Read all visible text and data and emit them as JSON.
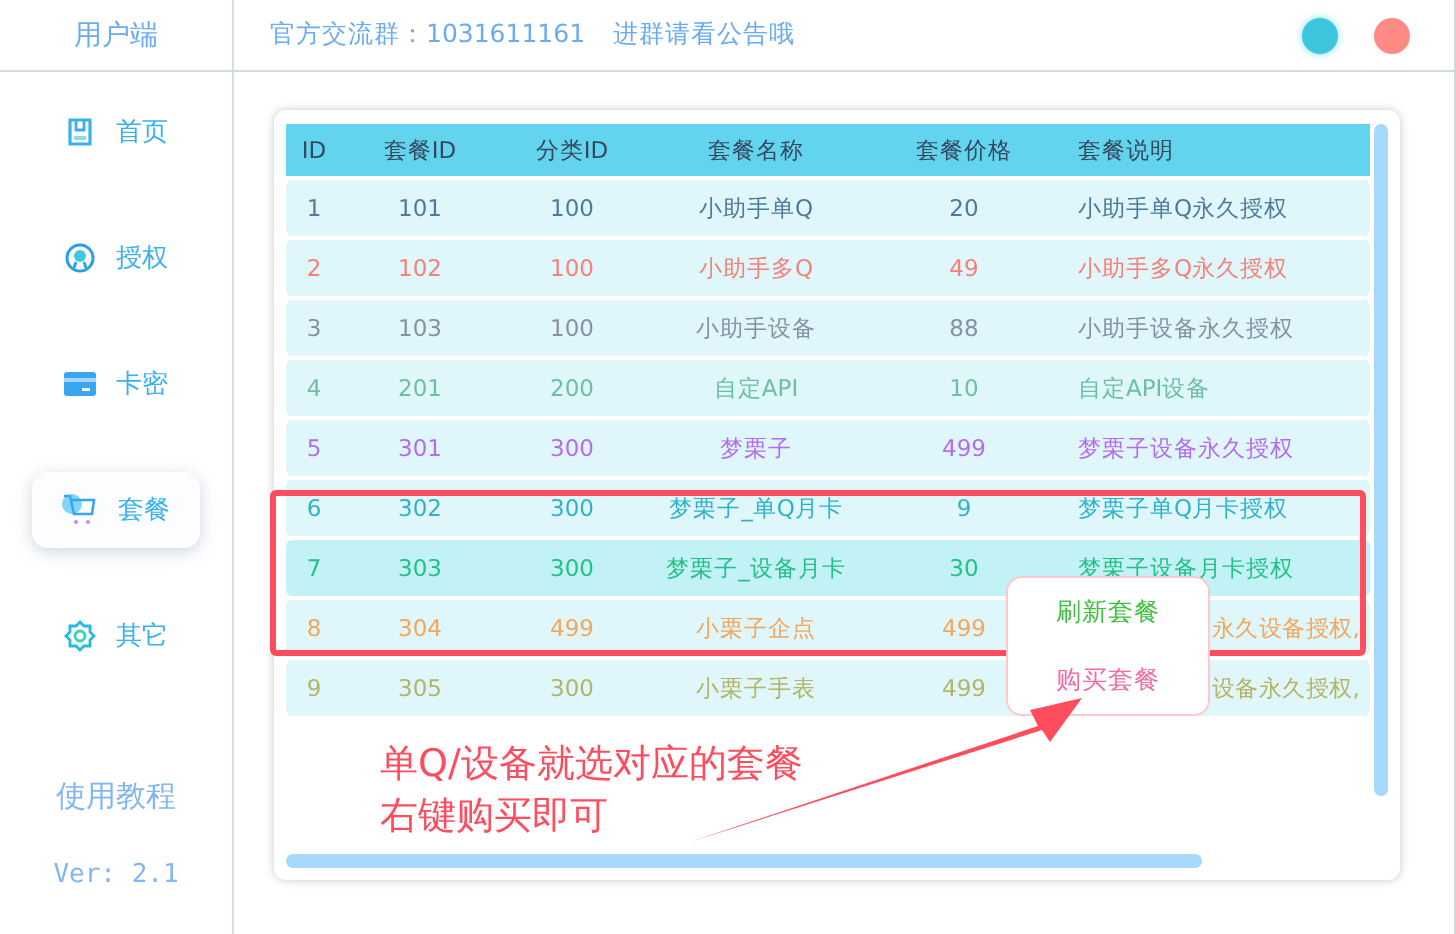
{
  "header": {
    "app_name": "用户端",
    "group_notice": "官方交流群：1031611161",
    "hint": "进群请看公告哦"
  },
  "sidebar": {
    "items": [
      {
        "label": "首页",
        "selected": false
      },
      {
        "label": "授权",
        "selected": false
      },
      {
        "label": "卡密",
        "selected": false
      },
      {
        "label": "套餐",
        "selected": true
      },
      {
        "label": "其它",
        "selected": false
      }
    ],
    "tutorial_link": "使用教程",
    "version": "Ver: 2.1"
  },
  "table": {
    "columns": [
      "ID",
      "套餐ID",
      "分类ID",
      "套餐名称",
      "套餐价格",
      "套餐说明"
    ],
    "rows": [
      {
        "cells": [
          "1",
          "101",
          "100",
          "小助手单Q",
          "20",
          "小助手单Q永久授权"
        ],
        "color": "#4f7a9c",
        "selected": false,
        "covered_by_menu": false
      },
      {
        "cells": [
          "2",
          "102",
          "100",
          "小助手多Q",
          "49",
          "小助手多Q永久授权"
        ],
        "color": "#f4817b",
        "selected": false,
        "covered_by_menu": false
      },
      {
        "cells": [
          "3",
          "103",
          "100",
          "小助手设备",
          "88",
          "小助手设备永久授权"
        ],
        "color": "#8592a3",
        "selected": false,
        "covered_by_menu": false
      },
      {
        "cells": [
          "4",
          "201",
          "200",
          "自定API",
          "10",
          "自定API设备"
        ],
        "color": "#6cbfa3",
        "selected": false,
        "covered_by_menu": false
      },
      {
        "cells": [
          "5",
          "301",
          "300",
          "梦栗子",
          "499",
          "梦栗子设备永久授权"
        ],
        "color": "#b46cf2",
        "selected": false,
        "covered_by_menu": false
      },
      {
        "cells": [
          "6",
          "302",
          "300",
          "梦栗子_单Q月卡",
          "9",
          "梦栗子单Q月卡授权"
        ],
        "color": "#2fb2c9",
        "selected": false,
        "covered_by_menu": false
      },
      {
        "cells": [
          "7",
          "303",
          "300",
          "梦栗子_设备月卡",
          "30",
          "梦栗子设备月卡授权"
        ],
        "color": "#25c087",
        "selected": true,
        "covered_by_menu": false
      },
      {
        "cells": [
          "8",
          "304",
          "499",
          "小栗子企点",
          "499",
          "永久设备授权,"
        ],
        "color": "#f5a65a",
        "selected": false,
        "covered_by_menu": true
      },
      {
        "cells": [
          "9",
          "305",
          "300",
          "小栗子手表",
          "499",
          "设备永久授权,"
        ],
        "color": "#b4b466",
        "selected": false,
        "covered_by_menu": true
      }
    ]
  },
  "context_menu": {
    "items": [
      {
        "label": "刷新套餐",
        "color": "#3cc23c"
      },
      {
        "label": "购买套餐",
        "color": "#f26aa8"
      }
    ]
  },
  "annotation": {
    "lines": [
      "单Q/设备就选对应的套餐",
      "右键购买即可"
    ]
  }
}
